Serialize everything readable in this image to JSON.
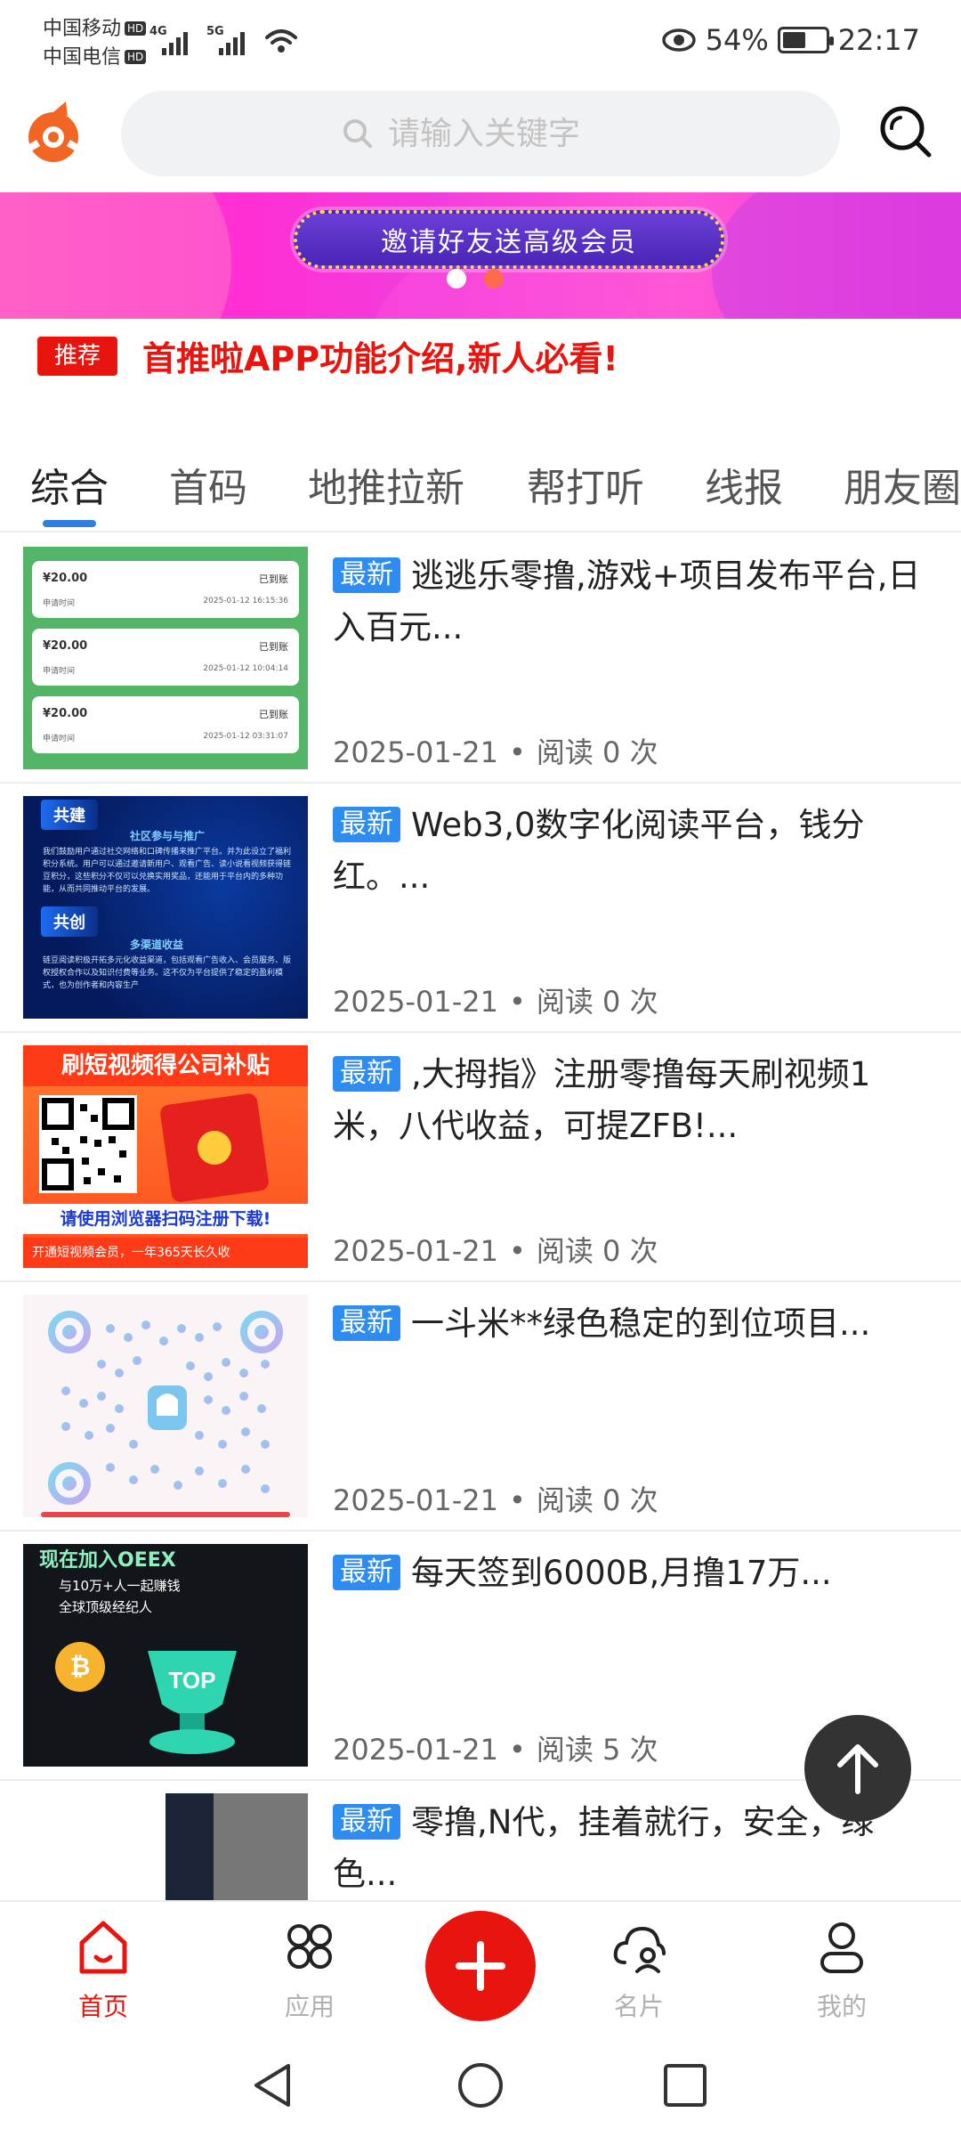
{
  "status_bar": {
    "carrier1": "中国移动",
    "carrier2": "中国电信",
    "hd": "HD",
    "sig1_gen": "4G",
    "sig2_gen": "5G",
    "battery_percent": "54%",
    "battery_level": 0.54,
    "time": "22:17"
  },
  "search": {
    "placeholder": "请输入关键字"
  },
  "banner": {
    "text": "邀请好友送高级会员",
    "active_dot": 0,
    "dot_count": 2
  },
  "notice": {
    "tag": "推荐",
    "text": "首推啦APP功能介绍,新人必看!"
  },
  "tabs": [
    "综合",
    "首码",
    "地推拉新",
    "帮打听",
    "线报",
    "朋友圈"
  ],
  "active_tab": 0,
  "list": [
    {
      "badge": "最新",
      "title": "逃逃乐零撸,游戏+项目发布平台,日入百元...",
      "date": "2025-01-21",
      "dot": "•",
      "read_label": "阅读",
      "read_count": "0",
      "read_unit": "次",
      "thumb": {
        "cards": [
          {
            "amount": "¥20.00",
            "status": "已到账",
            "label": "申请时间",
            "time": "2025-01-12 16:15:36"
          },
          {
            "amount": "¥20.00",
            "status": "已到账",
            "label": "申请时间",
            "time": "2025-01-12 10:04:14"
          },
          {
            "amount": "¥20.00",
            "status": "已到账",
            "label": "申请时间",
            "time": "2025-01-12 03:31:07"
          }
        ]
      }
    },
    {
      "badge": "最新",
      "title": "Web3,0数字化阅读平台，钱分红。...",
      "date": "2025-01-21",
      "dot": "•",
      "read_label": "阅读",
      "read_count": "0",
      "read_unit": "次",
      "thumb": {
        "h1": "共建",
        "s1": "社区参与与推广",
        "p1": "我们鼓励用户通过社交网络和口碑传播来推广平台。并为此设立了福利积分系统。用户可以通过邀请新用户、观看广告、读小说看视频获得链豆积分，这些积分不仅可以兑换实用奖品，还能用于平台内的多种功能，从而共同推动平台的发展。",
        "h2": "共创",
        "s2": "多渠道收益",
        "p2": "链豆阅读积极开拓多元化收益渠道，包括观看广告收入、会员服务、版权授权合作以及知识付费等业务。这不仅为平台提供了稳定的盈利模式，也为创作者和内容生产"
      }
    },
    {
      "badge": "最新",
      "title": ",大拇指》注册零撸每天刷视频1米，八代收益，可提ZFB!...",
      "date": "2025-01-21",
      "dot": "•",
      "read_label": "阅读",
      "read_count": "0",
      "read_unit": "次",
      "thumb": {
        "top": "刷短视频得公司补贴",
        "scan": "请使用浏览器扫码注册下载!",
        "bottom": "开通短视频会员，一年365天长久收"
      }
    },
    {
      "badge": "最新",
      "title": "一斗米**绿色稳定的到位项目...",
      "date": "2025-01-21",
      "dot": "•",
      "read_label": "阅读",
      "read_count": "0",
      "read_unit": "次"
    },
    {
      "badge": "最新",
      "title": "每天签到6000B,月撸17万...",
      "date": "2025-01-21",
      "dot": "•",
      "read_label": "阅读",
      "read_count": "5",
      "read_unit": "次",
      "thumb": {
        "line1": "现在加入OEEX",
        "line2": "与10万+人一起赚钱",
        "line3": "全球顶级经纪人",
        "trophy": "TOP",
        "coin": "₿"
      }
    },
    {
      "badge": "最新",
      "title": "零撸,N代，挂着就行，安全，绿色...",
      "date": "",
      "dot": "",
      "read_label": "",
      "read_count": "",
      "read_unit": ""
    }
  ],
  "bottom_nav": [
    {
      "label": "首页",
      "icon": "home-icon",
      "active": true
    },
    {
      "label": "应用",
      "icon": "apps-icon",
      "active": false
    },
    {
      "label": "",
      "icon": "plus-icon",
      "active": false
    },
    {
      "label": "名片",
      "icon": "card-cloud-icon",
      "active": false
    },
    {
      "label": "我的",
      "icon": "user-icon",
      "active": false
    }
  ],
  "colors": {
    "accent_red": "#e8140e",
    "badge_blue": "#2d8cf0",
    "tab_indicator": "#2e7fe0",
    "logo_orange": "#f26522"
  }
}
